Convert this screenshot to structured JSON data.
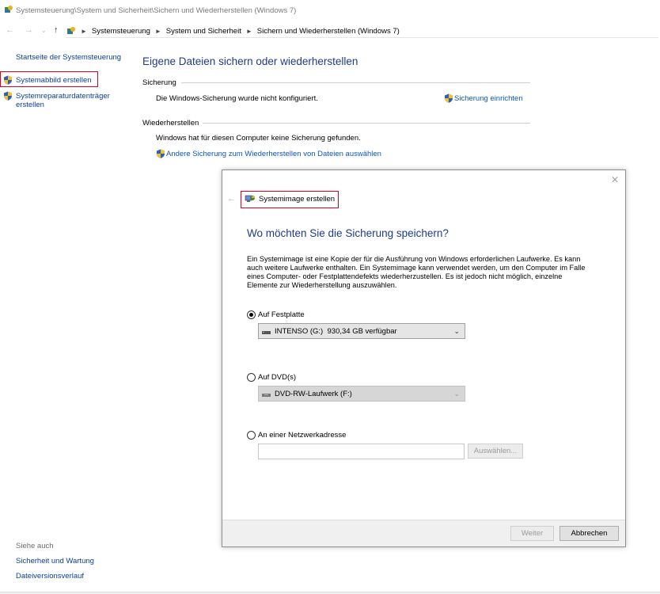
{
  "window": {
    "title": "Systemsteuerung\\System und Sicherheit\\Sichern und Wiederherstellen (Windows 7)"
  },
  "nav": {
    "back_icon": "arrow-left-icon",
    "forward_icon": "arrow-right-icon",
    "up_icon": "arrow-up-icon",
    "breadcrumbs": [
      "Systemsteuerung",
      "System und Sicherheit",
      "Sichern und Wiederherstellen (Windows 7)"
    ]
  },
  "sidebar": {
    "home_link": "Startseite der Systemsteuerung",
    "items": [
      {
        "label": "Systemabbild erstellen",
        "icon": "uac-shield-icon"
      },
      {
        "label_line1": "Systemreparaturdatenträger",
        "label_line2": "erstellen",
        "icon": "uac-shield-icon"
      }
    ],
    "see_also": {
      "title": "Siehe auch",
      "links": [
        "Sicherheit und Wartung",
        "Dateiversionsverlauf"
      ]
    }
  },
  "main": {
    "heading": "Eigene Dateien sichern oder wiederherstellen",
    "backup_group": {
      "label": "Sicherung",
      "status": "Die Windows-Sicherung wurde nicht konfiguriert.",
      "action": "Sicherung einrichten"
    },
    "restore_group": {
      "label": "Wiederherstellen",
      "status": "Windows hat für diesen Computer keine Sicherung gefunden.",
      "action": "Andere Sicherung zum Wiederherstellen von Dateien auswählen"
    }
  },
  "dialog": {
    "title": "Systemimage erstellen",
    "question": "Wo möchten Sie die Sicherung speichern?",
    "description": "Ein Systemimage ist eine Kopie der für die Ausführung von Windows erforderlichen Laufwerke. Es kann auch weitere Laufwerke enthalten. Ein Systemimage kann verwendet werden, um den Computer im Falle eines Computer- oder Festplattendefekts wiederherzustellen. Es ist jedoch nicht möglich, einzelne Elemente zur Wiederherstellung auszuwählen.",
    "options": [
      {
        "label": "Auf Festplatte",
        "checked": true,
        "select_value": "INTENSO (G:)  930,34 GB verfügbar"
      },
      {
        "label": "Auf DVD(s)",
        "checked": false,
        "select_value": "DVD-RW-Laufwerk (F:)"
      },
      {
        "label": "An einer Netzwerkadresse",
        "checked": false,
        "input_value": "",
        "browse_button": "Auswählen..."
      }
    ],
    "buttons": {
      "next": "Weiter",
      "cancel": "Abbrechen"
    }
  },
  "colors": {
    "link": "#0b3f9a",
    "heading": "#1e3b8c",
    "highlight_box": "#e0001b"
  }
}
